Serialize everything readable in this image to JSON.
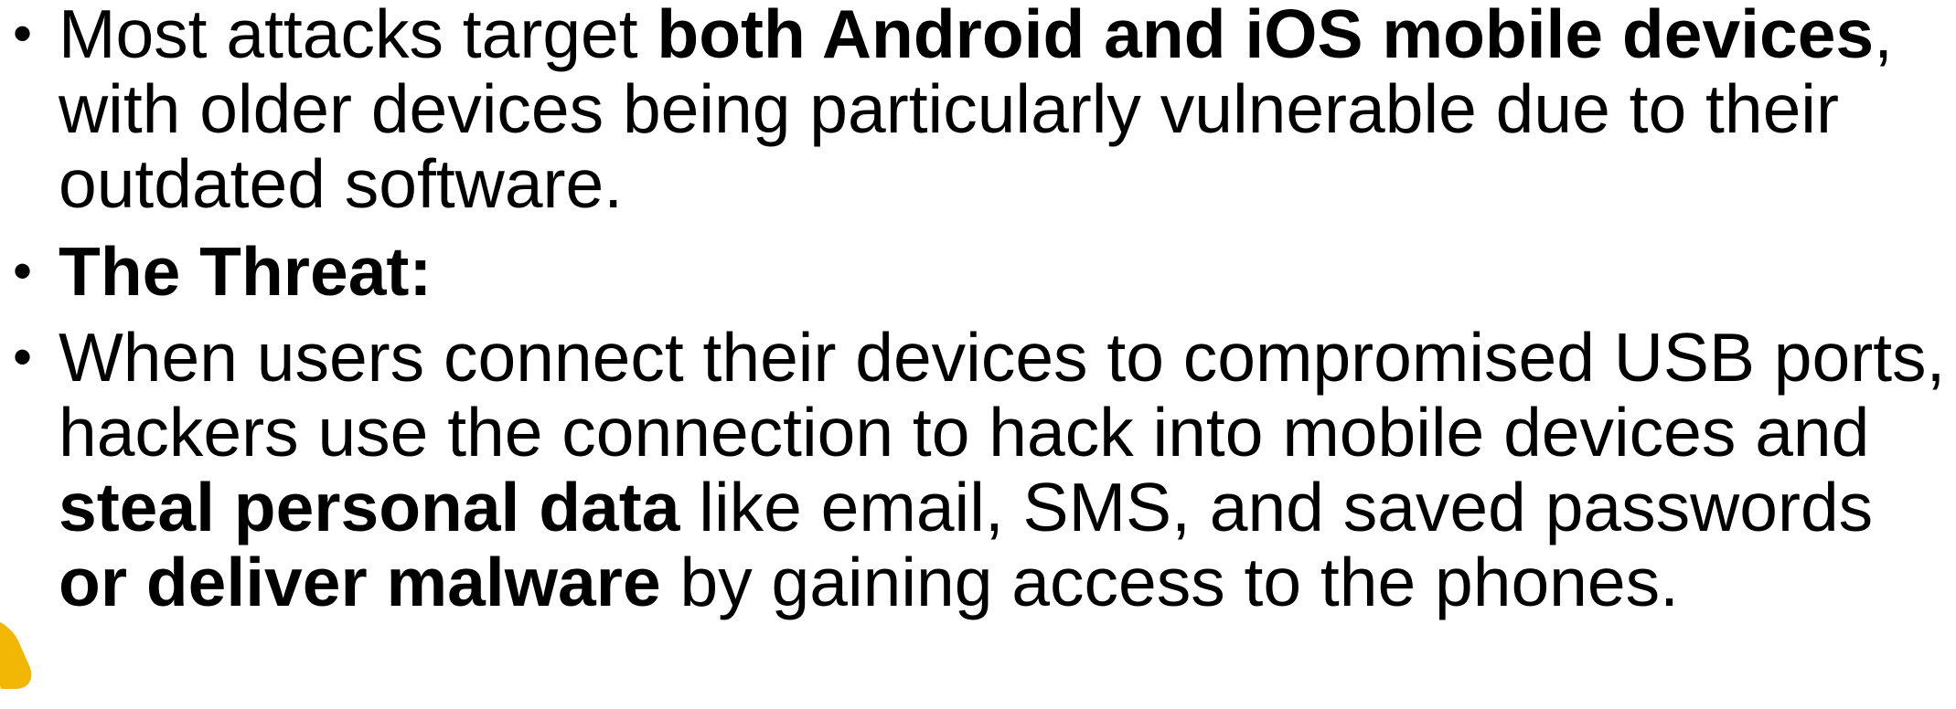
{
  "bullets": {
    "item1": {
      "text_a": "Most attacks target ",
      "text_b": "both Android and iOS mobile devices",
      "text_c": ", with older devices being particularly vulnerable due to their outdated software."
    },
    "item2": {
      "text_a": "The Threat:"
    },
    "item3": {
      "text_a": "When users connect their devices to compromised USB ports, hackers use the connection to hack into mobile devices and ",
      "text_b": "steal personal data",
      "text_c": " like email, SMS, and saved passwords ",
      "text_d": "or deliver malware",
      "text_e": " by gaining access to the phones."
    },
    "bullet_glyph": "•"
  },
  "colors": {
    "text": "#000000",
    "accent": "#f2b705",
    "background": "#ffffff"
  }
}
